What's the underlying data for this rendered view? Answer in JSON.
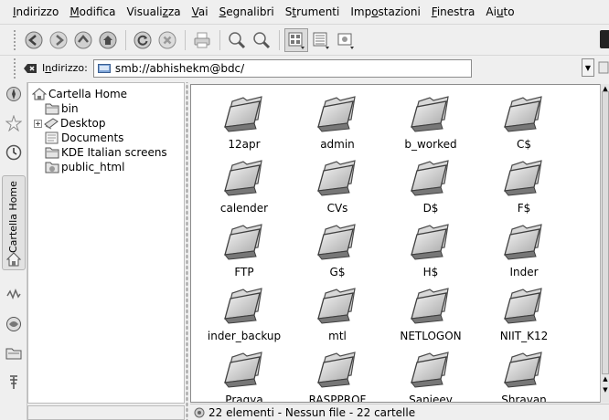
{
  "menubar": {
    "items": [
      {
        "pre": "",
        "u": "I",
        "post": "ndirizzo"
      },
      {
        "pre": "",
        "u": "M",
        "post": "odifica"
      },
      {
        "pre": "Visuali",
        "u": "z",
        "post": "za"
      },
      {
        "pre": "",
        "u": "V",
        "post": "ai"
      },
      {
        "pre": "",
        "u": "S",
        "post": "egnalibri"
      },
      {
        "pre": "S",
        "u": "t",
        "post": "rumenti"
      },
      {
        "pre": "Imp",
        "u": "o",
        "post": "stazioni"
      },
      {
        "pre": "",
        "u": "F",
        "post": "inestra"
      },
      {
        "pre": "Ai",
        "u": "u",
        "post": "to"
      }
    ]
  },
  "toolbar": {
    "buttons": [
      "back-icon",
      "forward-icon",
      "up-icon",
      "home-icon",
      "reload-icon",
      "stop-icon",
      "print-icon",
      "zoom-in-icon",
      "zoom-out-icon",
      "icon-view-icon",
      "detail-view-icon",
      "preview-view-icon"
    ]
  },
  "location": {
    "label_pre": "I",
    "label_u": "n",
    "label_post": "dirizzo:",
    "url": "smb://abhishekm@bdc/"
  },
  "sidebar": {
    "active_tab_label": "Cartella Home",
    "tabs": [
      "bookmarks-icon",
      "history-icon",
      "home-tab-icon",
      "network-icon",
      "services-icon",
      "folder-tab-icon",
      "trash-icon"
    ]
  },
  "tree": {
    "root": "Cartella Home",
    "items": [
      "bin",
      "Desktop",
      "Documents",
      "KDE Italian screens",
      "public_html"
    ]
  },
  "files": {
    "folders": [
      "12apr",
      "admin",
      "b_worked",
      "C$",
      "calender",
      "CVs",
      "D$",
      "F$",
      "FTP",
      "G$",
      "H$",
      "Inder",
      "inder_backup",
      "mtl",
      "NETLOGON",
      "NIIT_K12",
      "Pragya",
      "RASPPROF",
      "Sanjeev",
      "Shravan"
    ]
  },
  "status": {
    "text": "22 elementi - Nessun file - 22 cartelle"
  }
}
